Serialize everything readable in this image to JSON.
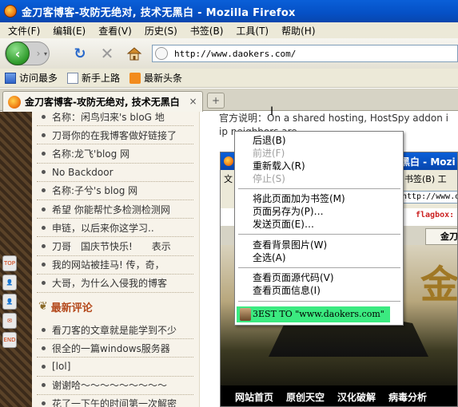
{
  "window": {
    "title": "金刀客博客-攻防无绝对, 技术无黑白 - Mozilla Firefox"
  },
  "menu": [
    "文件(F)",
    "编辑(E)",
    "查看(V)",
    "历史(S)",
    "书签(B)",
    "工具(T)",
    "帮助(H)"
  ],
  "nav": {
    "url": "http://www.daokers.com/",
    "back_glyph": "‹",
    "forward_glyph": "›"
  },
  "bookmarks": [
    {
      "label": "访问最多",
      "icon": "bookmarks-folder-icon"
    },
    {
      "label": "新手上路",
      "icon": "page-icon"
    },
    {
      "label": "最新头条",
      "icon": "rss-icon"
    }
  ],
  "tab": {
    "label": "金刀客博客-攻防无绝对, 技术无黑白",
    "close_glyph": "×",
    "new_tab_glyph": "+"
  },
  "sidebar": {
    "comments_top": [
      "名称：闲鸟归来's bloG 地",
      "刀哥你的在我博客做好链接了",
      "名称:龙飞'blog 网",
      "No Backdoor",
      "名称:子兮's blog 网",
      "希望 你能帮忙多检测检测网",
      "申链，以后来你这学习..",
      "刀哥　国庆节快乐!　　表示",
      "我的网站被挂马! 传，奇，",
      "大哥，为什么入侵我的博客"
    ],
    "section_title": "最新评论",
    "comments_bottom": [
      "看刀客的文章就是能学到不少",
      "很全的一篇windows服务器",
      "[lol]",
      "谢谢哈～～～～～～～～～",
      "花了一下午的时间第一次解密"
    ],
    "side_tools": [
      "TOP",
      "",
      "",
      "",
      "END"
    ]
  },
  "main": {
    "description_line1": "官方说明：On a shared hosting, HostSpy addon i",
    "description_line2": "ip neighbors are"
  },
  "embedded": {
    "title": "金刀客博客-攻防无黑白 - Mozi",
    "menu_left": "文",
    "menu_right": "书签(B)  工",
    "url": "http://www.da",
    "flag": "flagbox: 3",
    "tab": "金刀",
    "hero_glyph": "金",
    "nav_links": [
      "网站首页",
      "原创天空",
      "汉化破解",
      "病毒分析"
    ]
  },
  "context_menu": {
    "items": [
      {
        "label": "后退(B)",
        "enabled": true
      },
      {
        "label": "前进(F)",
        "enabled": false
      },
      {
        "label": "重新载入(R)",
        "enabled": true
      },
      {
        "label": "停止(S)",
        "enabled": false
      },
      {
        "label": "将此页面加为书签(M)",
        "enabled": true
      },
      {
        "label": "页面另存为(P)…",
        "enabled": true
      },
      {
        "label": "发送页面(E)…",
        "enabled": true
      },
      {
        "label": "查看背景图片(W)",
        "enabled": true
      },
      {
        "label": "全选(A)",
        "enabled": true
      },
      {
        "label": "查看页面源代码(V)",
        "enabled": true
      },
      {
        "label": "查看页面信息(I)",
        "enabled": true
      }
    ],
    "highlight": "3EST TO  \"www.daokers.com\""
  }
}
